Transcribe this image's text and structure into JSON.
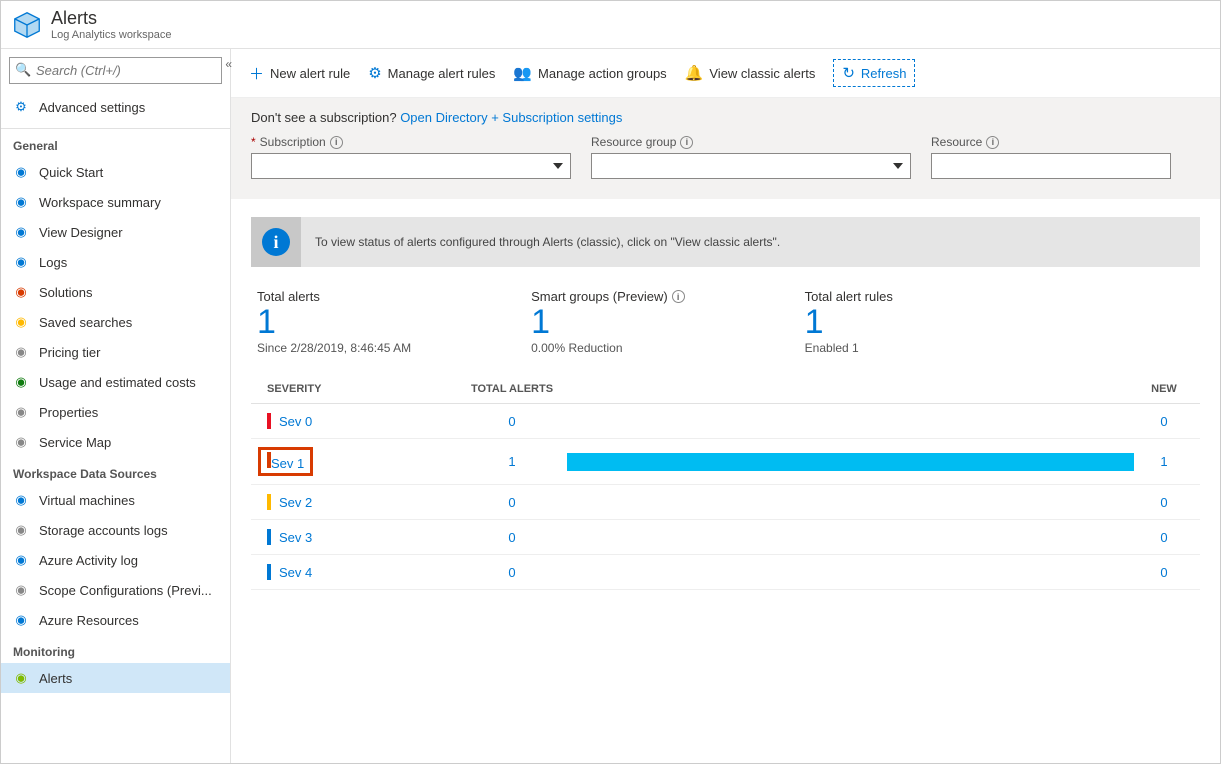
{
  "header": {
    "title": "Alerts",
    "subtitle": "Log Analytics workspace"
  },
  "search": {
    "placeholder": "Search (Ctrl+/)"
  },
  "sidebar": {
    "top_item": "Advanced settings",
    "sections": [
      {
        "label": "General",
        "items": [
          {
            "label": "Quick Start",
            "icon": "speedometer",
            "color": "#0078d4"
          },
          {
            "label": "Workspace summary",
            "icon": "grid",
            "color": "#0078d4"
          },
          {
            "label": "View Designer",
            "icon": "designer",
            "color": "#0078d4"
          },
          {
            "label": "Logs",
            "icon": "logs",
            "color": "#0078d4"
          },
          {
            "label": "Solutions",
            "icon": "solutions",
            "color": "#d83b01"
          },
          {
            "label": "Saved searches",
            "icon": "star",
            "color": "#ffb900"
          },
          {
            "label": "Pricing tier",
            "icon": "bars",
            "color": "#888"
          },
          {
            "label": "Usage and estimated costs",
            "icon": "usage",
            "color": "#107c10"
          },
          {
            "label": "Properties",
            "icon": "bars",
            "color": "#888"
          },
          {
            "label": "Service Map",
            "icon": "map",
            "color": "#888"
          }
        ]
      },
      {
        "label": "Workspace Data Sources",
        "items": [
          {
            "label": "Virtual machines",
            "icon": "vm",
            "color": "#0078d4"
          },
          {
            "label": "Storage accounts logs",
            "icon": "storage",
            "color": "#888"
          },
          {
            "label": "Azure Activity log",
            "icon": "activity",
            "color": "#0078d4"
          },
          {
            "label": "Scope Configurations (Previ...",
            "icon": "scope",
            "color": "#888"
          },
          {
            "label": "Azure Resources",
            "icon": "cube",
            "color": "#0078d4"
          }
        ]
      },
      {
        "label": "Monitoring",
        "items": [
          {
            "label": "Alerts",
            "icon": "alert",
            "color": "#7fba00",
            "active": true
          }
        ]
      }
    ]
  },
  "toolbar": {
    "new_rule": "New alert rule",
    "manage_rules": "Manage alert rules",
    "manage_groups": "Manage action groups",
    "view_classic": "View classic alerts",
    "refresh": "Refresh"
  },
  "filter": {
    "msg_prefix": "Don't see a subscription? ",
    "msg_link": "Open Directory + Subscription settings",
    "subscription_label": "Subscription",
    "resource_group_label": "Resource group",
    "resource_label": "Resource"
  },
  "info_banner": "To view status of alerts configured through Alerts (classic), click on \"View classic alerts\".",
  "stats": {
    "total_alerts": {
      "label": "Total alerts",
      "value": "1",
      "sub": "Since 2/28/2019, 8:46:45 AM"
    },
    "smart_groups": {
      "label": "Smart groups (Preview)",
      "value": "1",
      "sub": "0.00% Reduction"
    },
    "total_rules": {
      "label": "Total alert rules",
      "value": "1",
      "sub": "Enabled 1"
    }
  },
  "table": {
    "headers": {
      "severity": "SEVERITY",
      "total": "TOTAL ALERTS",
      "new": "NEW"
    },
    "rows": [
      {
        "name": "Sev 0",
        "color": "#e81123",
        "total": "0",
        "new": "0",
        "bar": 0,
        "hl": false
      },
      {
        "name": "Sev 1",
        "color": "#d83b01",
        "total": "1",
        "new": "1",
        "bar": 100,
        "hl": true
      },
      {
        "name": "Sev 2",
        "color": "#ffb900",
        "total": "0",
        "new": "0",
        "bar": 0,
        "hl": false
      },
      {
        "name": "Sev 3",
        "color": "#0078d4",
        "total": "0",
        "new": "0",
        "bar": 0,
        "hl": false
      },
      {
        "name": "Sev 4",
        "color": "#0078d4",
        "total": "0",
        "new": "0",
        "bar": 0,
        "hl": false
      }
    ]
  }
}
